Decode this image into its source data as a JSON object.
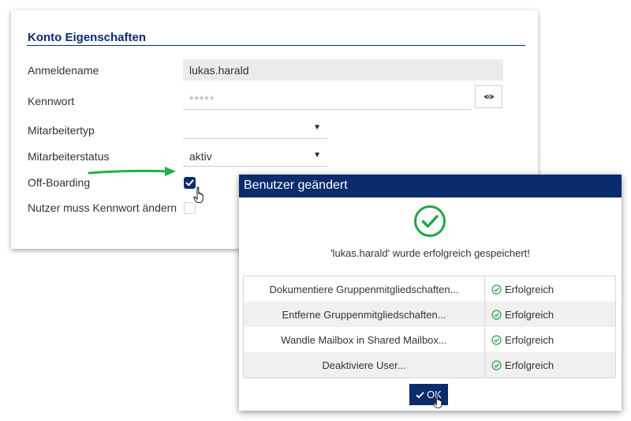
{
  "form": {
    "title": "Konto Eigenschaften",
    "labels": {
      "login": "Anmeldename",
      "password": "Kennwort",
      "employee_type": "Mitarbeitertyp",
      "employee_status": "Mitarbeiterstatus",
      "offboarding": "Off-Boarding",
      "must_change_pw": "Nutzer muss Kennwort ändern"
    },
    "values": {
      "login": "lukas.harald",
      "password_mask": "*****",
      "employee_type": "",
      "employee_status": "aktiv"
    },
    "checkboxes": {
      "offboarding": true,
      "must_change_pw": false
    }
  },
  "dialog": {
    "title": "Benutzer geändert",
    "message": "'lukas.harald' wurde erfolgreich gespeichert!",
    "steps": [
      {
        "name": "Dokumentiere Gruppenmitgliedschaften...",
        "status": "Erfolgreich"
      },
      {
        "name": "Entferne Gruppenmitgliedschaften...",
        "status": "Erfolgreich"
      },
      {
        "name": "Wandle Mailbox in Shared Mailbox...",
        "status": "Erfolgreich"
      },
      {
        "name": "Deaktiviere User...",
        "status": "Erfolgreich"
      }
    ],
    "ok_label": "OK"
  },
  "colors": {
    "brand": "#0a2c6c",
    "success": "#22a447",
    "arrow": "#22b04b"
  },
  "icons": {
    "eye": "eye-icon",
    "success": "check-circle-icon",
    "cursor": "hand-pointer-icon"
  }
}
